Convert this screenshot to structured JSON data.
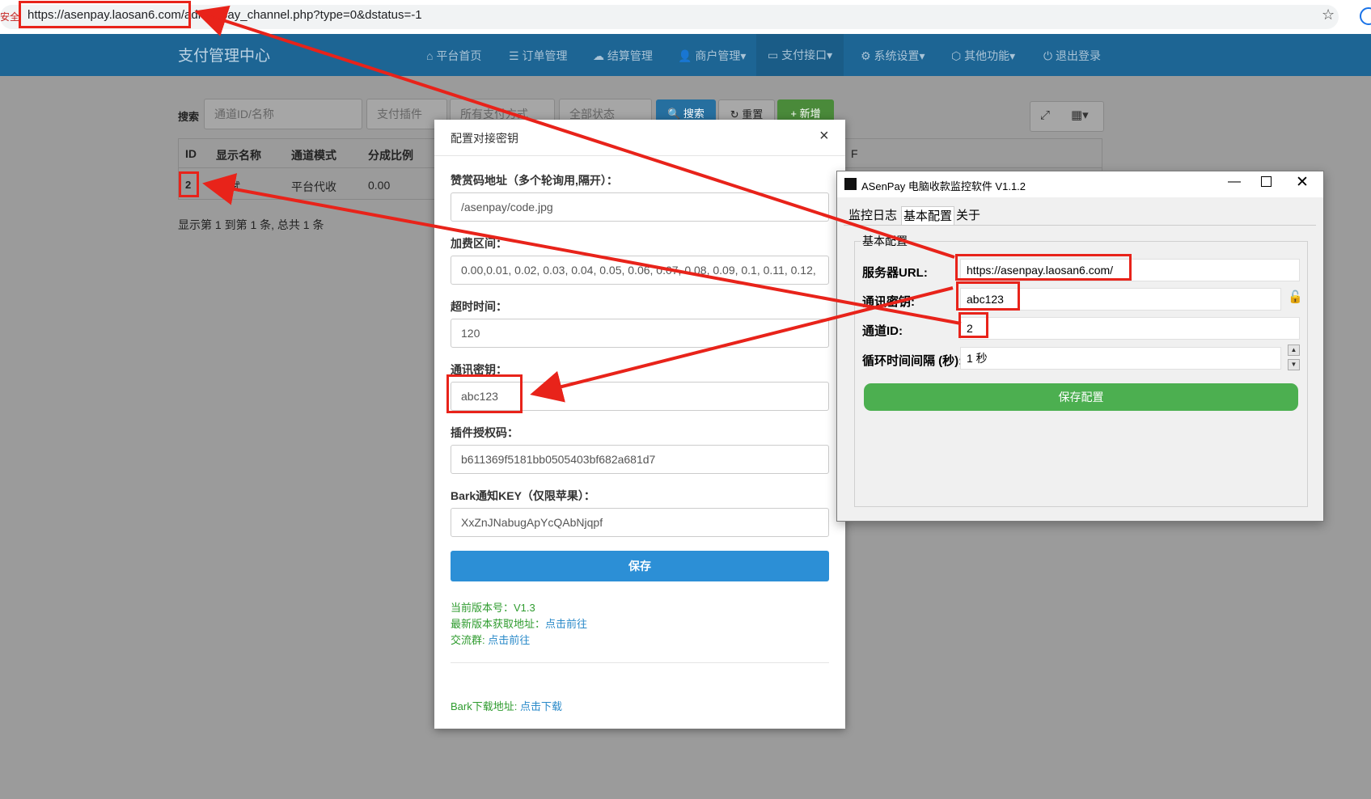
{
  "browser": {
    "insecure_label": "安全",
    "url_host": "https://asenpay.laosan6.com/",
    "url_path": "admin/pay_channel.php?type=0&dstatus=-1",
    "star_icon": "☆"
  },
  "navbar": {
    "brand": "支付管理中心",
    "items": [
      {
        "icon": "⌂",
        "label": "平台首页"
      },
      {
        "icon": "☰",
        "label": "订单管理"
      },
      {
        "icon": "☁",
        "label": "结算管理"
      },
      {
        "icon": "👤",
        "label": "商户管理▾"
      },
      {
        "icon": "▭",
        "label": "支付接口▾"
      },
      {
        "icon": "⚙",
        "label": "系统设置▾"
      },
      {
        "icon": "⬡",
        "label": "其他功能▾"
      },
      {
        "icon": "⏻",
        "label": "退出登录"
      }
    ]
  },
  "search": {
    "label": "搜索",
    "channel_placeholder": "通道ID/名称",
    "plugin_placeholder": "支付插件",
    "method_select": "所有支付方式",
    "status_select": "全部状态",
    "search_button": "搜索",
    "reset_button": "重置",
    "add_button": "新增"
  },
  "table": {
    "headers": [
      "ID",
      "显示名称",
      "通道模式",
      "分成比例"
    ],
    "header_tail": "F",
    "rows": [
      [
        "2",
        "测试",
        "平台代收",
        "0.00"
      ]
    ],
    "footer": "显示第 1 到第 1 条, 总共 1 条"
  },
  "modal": {
    "title": "配置对接密钥",
    "fields": [
      {
        "label": "赞赏码地址（多个轮询用,隔开）：",
        "value": "/asenpay/code.jpg"
      },
      {
        "label": "加费区间：",
        "value": "0.00,0.01, 0.02, 0.03, 0.04, 0.05, 0.06, 0.07, 0.08, 0.09, 0.1, 0.11, 0.12,"
      },
      {
        "label": "超时时间：",
        "value": "120"
      },
      {
        "label": "通讯密钥：",
        "value": "abc123"
      },
      {
        "label": "插件授权码：",
        "value": "b611369f5181bb0505403bf682a681d7"
      },
      {
        "label": "Bark通知KEY（仅限苹果）：",
        "value": "XxZnJNabugApYcQAbNjqpf"
      }
    ],
    "save_button": "保存",
    "version_label": "当前版本号：V1.3",
    "latest_label": "最新版本获取地址：",
    "latest_link": "点击前往",
    "group_label": "交流群:",
    "group_link": "点击前往",
    "bark_label": "Bark下载地址:",
    "bark_link": "点击下载"
  },
  "app": {
    "title": "ASenPay 电脑收款监控软件 V1.1.2",
    "tabs": [
      "监控日志",
      "基本配置",
      "关于"
    ],
    "group_title": "基本配置",
    "fields": [
      {
        "label": "服务器URL:",
        "value": "https://asenpay.laosan6.com/"
      },
      {
        "label": "通讯密钥:",
        "value": "abc123"
      },
      {
        "label": "通道ID:",
        "value": "2"
      },
      {
        "label": "循环时间间隔 (秒):",
        "value": "1 秒"
      }
    ],
    "save_button": "保存配置",
    "colors": {
      "save_button": "#4caf50"
    }
  },
  "colors": {
    "navbar": "#1d6594",
    "annotation": "#e8231a",
    "primary_button": "#2c8fd6"
  }
}
